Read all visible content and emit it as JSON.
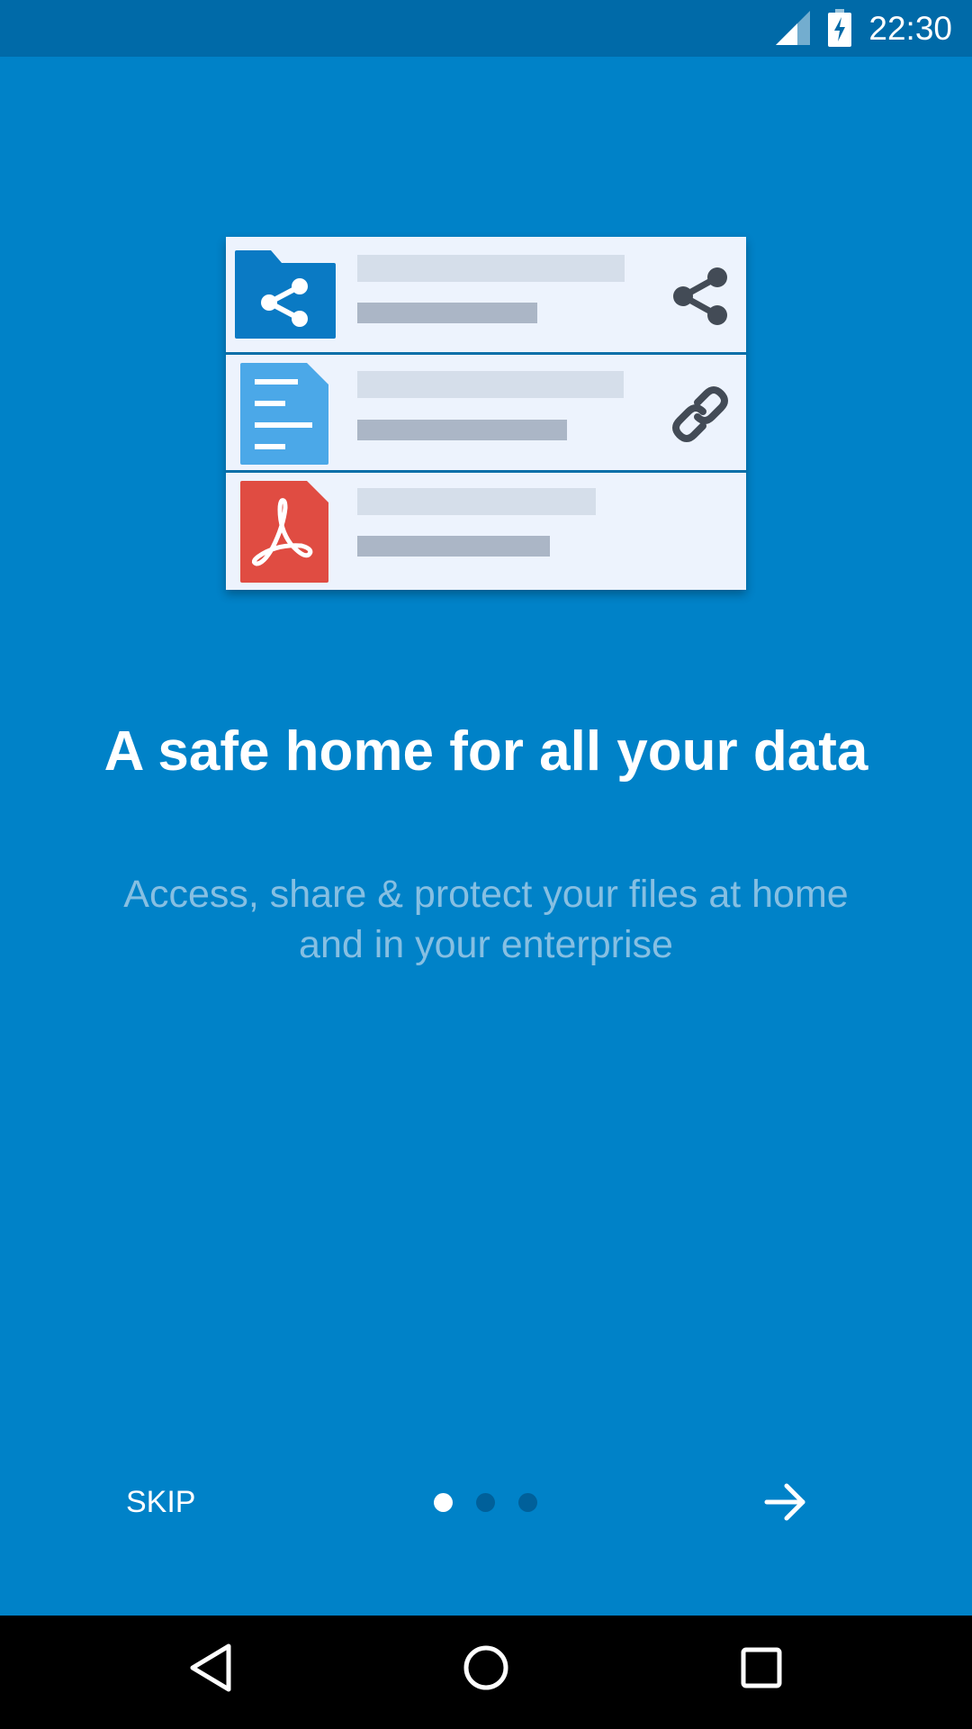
{
  "status_bar": {
    "time": "22:30",
    "icons": [
      "signal-icon",
      "battery-charging-icon"
    ]
  },
  "illustration": {
    "rows": [
      {
        "icon": "shared-folder-icon",
        "action_icon": "share-icon"
      },
      {
        "icon": "document-icon",
        "action_icon": "link-icon"
      },
      {
        "icon": "pdf-icon",
        "action_icon": ""
      }
    ]
  },
  "onboarding": {
    "title": "A safe home for all your data",
    "subtitle_line1": "Access, share & protect your files at home",
    "subtitle_line2": "and in your enterprise",
    "page_count": 3,
    "current_page": 1
  },
  "footer": {
    "skip_label": "SKIP",
    "next_icon": "arrow-right-icon"
  },
  "navigation_bar": {
    "icons": [
      "back-icon",
      "home-icon",
      "recents-icon"
    ]
  },
  "colors": {
    "background": "#0082c8",
    "status_bar": "#006aa8",
    "folder_blue": "#0a7ac4",
    "doc_blue": "#4ba8e8",
    "pdf_red": "#e04c42",
    "card": "#edf3fd"
  }
}
